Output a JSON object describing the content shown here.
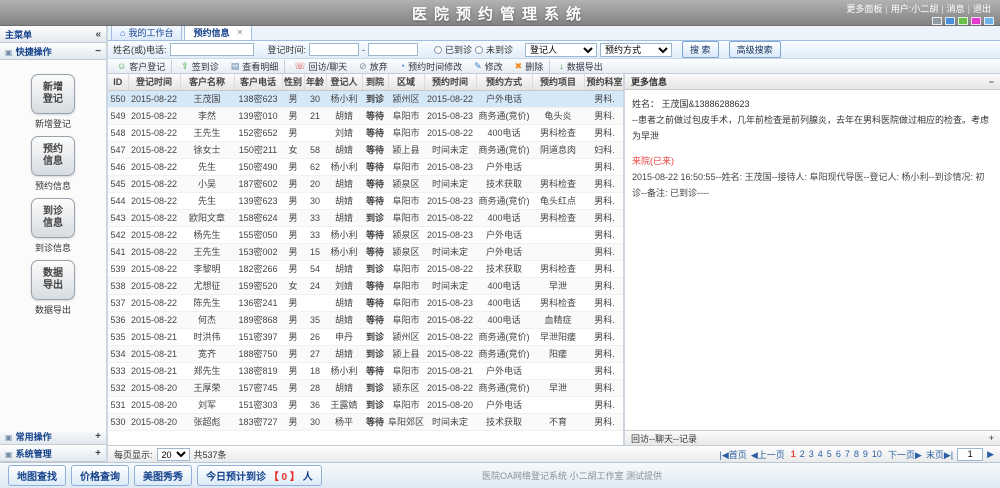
{
  "app": {
    "title": "医院预约管理系统",
    "top_links": [
      "更多面板",
      "用户:小二胡",
      "消息",
      "退出"
    ],
    "skin_colors": [
      "#8f9aa3",
      "#4a90d9",
      "#6abf4b",
      "#e43bd0",
      "#6db3e8"
    ]
  },
  "sidebar": {
    "title": "主菜单",
    "collapse_glyph": "«",
    "sections": [
      {
        "label": "快捷操作",
        "toggle": "−"
      },
      {
        "label": "常用操作",
        "toggle": "+"
      },
      {
        "label": "系统管理",
        "toggle": "+"
      }
    ],
    "shortcuts": [
      {
        "l1": "新增",
        "l2": "登记",
        "label": "新增登记"
      },
      {
        "l1": "预约",
        "l2": "信息",
        "label": "预约信息"
      },
      {
        "l1": "到诊",
        "l2": "信息",
        "label": "到诊信息"
      },
      {
        "l1": "数据",
        "l2": "导出",
        "label": "数据导出"
      }
    ]
  },
  "tabs": [
    {
      "label": "我的工作台"
    },
    {
      "label": "预约信息"
    }
  ],
  "filters": {
    "name_label": "姓名(或)电话:",
    "time_label": "登记时间:",
    "time_sep": "-",
    "arrived": "已到诊",
    "not_arrived": "未到诊",
    "registrar_select": "登记人",
    "method_select": "预约方式",
    "search": "搜 索",
    "advanced": "高级搜索"
  },
  "toolbar": {
    "items": [
      {
        "label": "客户登记",
        "icon": "☺",
        "icon_name": "person-icon",
        "color": "#3da53d",
        "name": "customer-register",
        "sep": true
      },
      {
        "label": "签到诊",
        "icon": "⇧",
        "icon_name": "sign-in-icon",
        "color": "#3da53d",
        "name": "sign-in"
      },
      {
        "label": "查看明细",
        "icon": "▤",
        "icon_name": "detail-icon",
        "color": "#5b7fa6",
        "name": "view-detail",
        "sep": true
      },
      {
        "label": "回访/聊天",
        "icon": "☏",
        "icon_name": "phone-icon",
        "color": "#d9342b",
        "name": "callback-chat"
      },
      {
        "label": "放弃",
        "icon": "⊘",
        "icon_name": "abandon-icon",
        "color": "#7a8ea0",
        "name": "abandon"
      },
      {
        "label": "预约时间修改",
        "icon": "◔",
        "icon_name": "clock-icon",
        "color": "#3d7edb",
        "name": "appointment-time-edit"
      },
      {
        "label": "修改",
        "icon": "✎",
        "icon_name": "edit-icon",
        "color": "#3d7edb",
        "name": "edit"
      },
      {
        "label": "删除",
        "icon": "✖",
        "icon_name": "delete-icon",
        "color": "#f08a24",
        "name": "delete",
        "sep": true
      },
      {
        "label": "数据导出",
        "icon": "↓",
        "icon_name": "export-icon",
        "color": "#3da53d",
        "name": "data-export"
      }
    ]
  },
  "table": {
    "columns": [
      "ID",
      "登记时间",
      "客户名称",
      "客户电话",
      "性别",
      "年龄",
      "登记人",
      "到院",
      "区域",
      "预约时间",
      "预约方式",
      "预约项目",
      "预约科室"
    ],
    "rows": [
      {
        "id": "550",
        "reg": "2015-08-22",
        "name": "王茂国",
        "phone": "138密623",
        "sex": "男",
        "age": "30",
        "registrar": "杨小利",
        "arrive": "到诊",
        "region": "颍州区",
        "appt": "2015-08-22",
        "method": "户外电话",
        "project": "",
        "dept": "男科.",
        "selected": true
      },
      {
        "id": "549",
        "reg": "2015-08-22",
        "name": "李然",
        "phone": "139密010",
        "sex": "男",
        "age": "21",
        "registrar": "胡婧",
        "arrive": "等待",
        "region": "阜阳市",
        "appt": "2015-08-23",
        "method": "商务通(竞价)",
        "project": "龟头炎",
        "dept": "男科."
      },
      {
        "id": "548",
        "reg": "2015-08-22",
        "name": "王先生",
        "phone": "152密652",
        "sex": "男",
        "age": "",
        "registrar": "刘婧",
        "arrive": "等待",
        "region": "阜阳市",
        "appt": "2015-08-22",
        "method": "400电话",
        "project": "男科检查",
        "dept": "男科."
      },
      {
        "id": "547",
        "reg": "2015-08-22",
        "name": "徐女士",
        "phone": "150密211",
        "sex": "女",
        "age": "58",
        "registrar": "胡婧",
        "arrive": "等待",
        "region": "颍上县",
        "appt": "时间未定",
        "method": "商务通(竞价)",
        "project": "阴道息肉",
        "dept": "妇科."
      },
      {
        "id": "546",
        "reg": "2015-08-22",
        "name": "先生",
        "phone": "150密490",
        "sex": "男",
        "age": "62",
        "registrar": "杨小利",
        "arrive": "等待",
        "region": "阜阳市",
        "appt": "2015-08-23",
        "method": "户外电话",
        "project": "",
        "dept": "男科."
      },
      {
        "id": "545",
        "reg": "2015-08-22",
        "name": "小吴",
        "phone": "187密602",
        "sex": "男",
        "age": "20",
        "registrar": "胡婧",
        "arrive": "等待",
        "region": "颍泉区",
        "appt": "时间未定",
        "method": "技术获取",
        "project": "男科检查",
        "dept": "男科."
      },
      {
        "id": "544",
        "reg": "2015-08-22",
        "name": "先生",
        "phone": "139密623",
        "sex": "男",
        "age": "30",
        "registrar": "胡婧",
        "arrive": "等待",
        "region": "阜阳市",
        "appt": "2015-08-23",
        "method": "商务通(竞价)",
        "project": "龟头红点",
        "dept": "男科."
      },
      {
        "id": "543",
        "reg": "2015-08-22",
        "name": "欧阳文章",
        "phone": "158密624",
        "sex": "男",
        "age": "33",
        "registrar": "胡婧",
        "arrive": "到诊",
        "region": "阜阳市",
        "appt": "2015-08-22",
        "method": "400电话",
        "project": "男科检查",
        "dept": "男科."
      },
      {
        "id": "542",
        "reg": "2015-08-22",
        "name": "杨先生",
        "phone": "155密050",
        "sex": "男",
        "age": "33",
        "registrar": "杨小利",
        "arrive": "等待",
        "region": "颍泉区",
        "appt": "2015-08-23",
        "method": "户外电话",
        "project": "",
        "dept": "男科."
      },
      {
        "id": "541",
        "reg": "2015-08-22",
        "name": "王先生",
        "phone": "153密002",
        "sex": "男",
        "age": "15",
        "registrar": "杨小利",
        "arrive": "等待",
        "region": "颍泉区",
        "appt": "时间未定",
        "method": "户外电话",
        "project": "",
        "dept": "男科."
      },
      {
        "id": "539",
        "reg": "2015-08-22",
        "name": "李黎明",
        "phone": "182密266",
        "sex": "男",
        "age": "54",
        "registrar": "胡婧",
        "arrive": "到诊",
        "region": "阜阳市",
        "appt": "2015-08-22",
        "method": "技术获取",
        "project": "男科检查",
        "dept": "男科."
      },
      {
        "id": "538",
        "reg": "2015-08-22",
        "name": "尤想征",
        "phone": "159密520",
        "sex": "女",
        "age": "24",
        "registrar": "刘婧",
        "arrive": "等待",
        "region": "阜阳市",
        "appt": "时间未定",
        "method": "400电话",
        "project": "早泄",
        "dept": "男科."
      },
      {
        "id": "537",
        "reg": "2015-08-22",
        "name": "陈先生",
        "phone": "136密241",
        "sex": "男",
        "age": "",
        "registrar": "胡婧",
        "arrive": "等待",
        "region": "阜阳市",
        "appt": "2015-08-23",
        "method": "400电话",
        "project": "男科检查",
        "dept": "男科."
      },
      {
        "id": "536",
        "reg": "2015-08-22",
        "name": "何杰",
        "phone": "189密868",
        "sex": "男",
        "age": "35",
        "registrar": "胡婧",
        "arrive": "等待",
        "region": "阜阳市",
        "appt": "2015-08-22",
        "method": "400电话",
        "project": "血精症",
        "dept": "男科."
      },
      {
        "id": "535",
        "reg": "2015-08-21",
        "name": "时洪伟",
        "phone": "151密397",
        "sex": "男",
        "age": "26",
        "registrar": "申丹",
        "arrive": "到诊",
        "region": "颍州区",
        "appt": "2015-08-22",
        "method": "商务通(竞价)",
        "project": "早泄阳痿",
        "dept": "男科."
      },
      {
        "id": "534",
        "reg": "2015-08-21",
        "name": "宽齐",
        "phone": "188密750",
        "sex": "男",
        "age": "27",
        "registrar": "胡婧",
        "arrive": "到诊",
        "region": "颍上县",
        "appt": "2015-08-22",
        "method": "商务通(竞价)",
        "project": "阳痿",
        "dept": "男科."
      },
      {
        "id": "533",
        "reg": "2015-08-21",
        "name": "郑先生",
        "phone": "138密819",
        "sex": "男",
        "age": "18",
        "registrar": "杨小利",
        "arrive": "等待",
        "region": "阜阳市",
        "appt": "2015-08-21",
        "method": "户外电话",
        "project": "",
        "dept": "男科."
      },
      {
        "id": "532",
        "reg": "2015-08-20",
        "name": "王厚荣",
        "phone": "157密745",
        "sex": "男",
        "age": "28",
        "registrar": "胡婧",
        "arrive": "到诊",
        "region": "颍东区",
        "appt": "2015-08-22",
        "method": "商务通(竞价)",
        "project": "早泄",
        "dept": "男科."
      },
      {
        "id": "531",
        "reg": "2015-08-20",
        "name": "刘军",
        "phone": "151密303",
        "sex": "男",
        "age": "36",
        "registrar": "王露婧",
        "arrive": "到诊",
        "region": "阜阳市",
        "appt": "2015-08-20",
        "method": "户外电话",
        "project": "",
        "dept": "男科."
      },
      {
        "id": "530",
        "reg": "2015-08-20",
        "name": "张超彪",
        "phone": "183密727",
        "sex": "男",
        "age": "30",
        "registrar": "杨平",
        "arrive": "等待",
        "region": "阜阳郊区",
        "appt": "时间未定",
        "method": "技术获取",
        "project": "不育",
        "dept": "男科."
      }
    ]
  },
  "info_panel": {
    "title": "更多信息",
    "toggle": "−",
    "name_line": "姓名： 王茂国&13886288623",
    "desc": "--患者之前做过包皮手术，几年前检查是前列腺炎，去年在男科医院做过相应的检查。考虑为早泄",
    "visit_status": "来院(已来)",
    "record": "2015-08-22 16:50:55--姓名: 王茂国--接待人: 阜阳现代导医--登记人: 杨小利--到诊情况: 初诊--备注: 已到诊----",
    "bottom_title": "回访--聊天--记录",
    "bottom_toggle": "+"
  },
  "pager": {
    "per_page_label": "每页显示:",
    "per_page": "20",
    "total": "共537条",
    "first": "|◀首页",
    "prev": "◀上一页",
    "pages": [
      "1",
      "2",
      "3",
      "4",
      "5",
      "6",
      "7",
      "8",
      "9",
      "10"
    ],
    "current": "1",
    "next": "下一页▶",
    "last": "末页▶|",
    "goto_value": "1",
    "go_glyph": "▶"
  },
  "footer": {
    "map_btn": "地图查找",
    "price_btn": "价格查询",
    "meitu_btn": "美图秀秀",
    "today_prefix": "今日预计到诊",
    "today_count": "【 0 】",
    "today_suffix": "人",
    "credit": "医院OA网络登记系统 小二胡工作室 测试提供"
  }
}
